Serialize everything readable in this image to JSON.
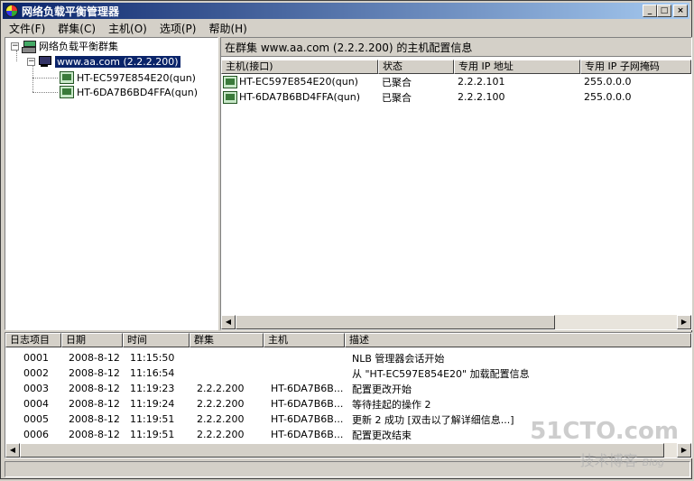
{
  "window": {
    "title": "网络负载平衡管理器"
  },
  "menu": [
    "文件(F)",
    "群集(C)",
    "主机(O)",
    "选项(P)",
    "帮助(H)"
  ],
  "tree": {
    "root": "网络负载平衡群集",
    "cluster": "www.aa.com (2.2.2.200)",
    "hosts": [
      "HT-EC597E854E20(qun)",
      "HT-6DA7B6BD4FFA(qun)"
    ]
  },
  "right": {
    "caption": "在群集 www.aa.com (2.2.2.200) 的主机配置信息",
    "columns": [
      "主机(接口)",
      "状态",
      "专用 IP 地址",
      "专用 IP 子网掩码"
    ],
    "rows": [
      [
        "HT-EC597E854E20(qun)",
        "已聚合",
        "2.2.2.101",
        "255.0.0.0"
      ],
      [
        "HT-6DA7B6BD4FFA(qun)",
        "已聚合",
        "2.2.2.100",
        "255.0.0.0"
      ]
    ]
  },
  "log": {
    "columns": [
      "日志项目",
      "日期",
      "时间",
      "群集",
      "主机",
      "描述"
    ],
    "rows": [
      [
        "0001",
        "2008-8-12",
        "11:15:50",
        "",
        "",
        "NLB 管理器会话开始"
      ],
      [
        "0002",
        "2008-8-12",
        "11:16:54",
        "",
        "",
        "从 \"HT-EC597E854E20\" 加载配置信息"
      ],
      [
        "0003",
        "2008-8-12",
        "11:19:23",
        "2.2.2.200",
        "HT-6DA7B6B...",
        "配置更改开始"
      ],
      [
        "0004",
        "2008-8-12",
        "11:19:24",
        "2.2.2.200",
        "HT-6DA7B6B...",
        "等待挂起的操作 2"
      ],
      [
        "0005",
        "2008-8-12",
        "11:19:51",
        "2.2.2.200",
        "HT-6DA7B6B...",
        "更新 2 成功 [双击以了解详细信息...]"
      ],
      [
        "0006",
        "2008-8-12",
        "11:19:51",
        "2.2.2.200",
        "HT-6DA7B6B...",
        "配置更改结束"
      ]
    ]
  },
  "watermark": {
    "main": "51CTO.com",
    "sub": "技术博客",
    "tag": "Blog"
  }
}
